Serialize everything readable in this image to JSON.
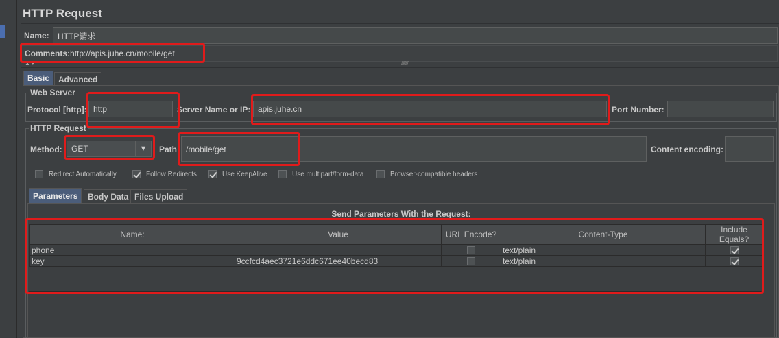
{
  "title": "HTTP Request",
  "name": {
    "label": "Name:",
    "value": "HTTP请求"
  },
  "comments": {
    "label": "Comments:",
    "value": "http://apis.juhe.cn/mobile/get"
  },
  "main_tabs": [
    {
      "label": "Basic",
      "active": true
    },
    {
      "label": "Advanced",
      "active": false
    }
  ],
  "web_server": {
    "title": "Web Server",
    "protocol_label": "Protocol [http]:",
    "protocol_value": "http",
    "server_label": "Server Name or IP:",
    "server_value": "apis.juhe.cn",
    "port_label": "Port Number:",
    "port_value": ""
  },
  "http_request": {
    "title": "HTTP Request",
    "method_label": "Method:",
    "method_value": "GET",
    "path_label": "Path:",
    "path_value": "/mobile/get",
    "encoding_label": "Content encoding:",
    "encoding_value": ""
  },
  "options": [
    {
      "label": "Redirect Automatically",
      "checked": false
    },
    {
      "label": "Follow Redirects",
      "checked": true
    },
    {
      "label": "Use KeepAlive",
      "checked": true
    },
    {
      "label": "Use multipart/form-data",
      "checked": false
    },
    {
      "label": "Browser-compatible headers",
      "checked": false
    }
  ],
  "sub_tabs": [
    {
      "label": "Parameters",
      "active": true
    },
    {
      "label": "Body Data",
      "active": false
    },
    {
      "label": "Files Upload",
      "active": false
    }
  ],
  "params": {
    "title": "Send Parameters With the Request:",
    "columns": [
      "Name:",
      "Value",
      "URL Encode?",
      "Content-Type",
      "Include Equals?"
    ],
    "rows": [
      {
        "name": "phone",
        "value": "",
        "url_encode": false,
        "content_type": "text/plain",
        "include_equals": true
      },
      {
        "name": "key",
        "value": "9ccfcd4aec3721e6ddc671ee40becd83",
        "url_encode": false,
        "content_type": "text/plain",
        "include_equals": true
      }
    ]
  },
  "colors": {
    "background": "#3c3f41",
    "field": "#45494a",
    "highlight": "#e01b1b",
    "active_tab": "#4b5d7a"
  }
}
